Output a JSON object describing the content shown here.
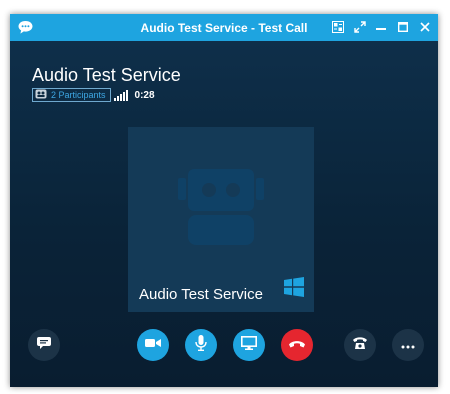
{
  "window": {
    "title": "Audio Test Service - Test Call"
  },
  "call": {
    "contact_name": "Audio Test Service",
    "participants_label": "2 Participants",
    "duration": "0:28",
    "tile_name": "Audio Test Service"
  },
  "icons": {
    "app": "chat-bubble-icon",
    "popout": "popout-icon",
    "fullscreen": "fullscreen-icon",
    "minimize": "minimize-icon",
    "maximize": "maximize-icon",
    "close": "close-icon",
    "conversation": "chat-icon",
    "video": "video-camera-icon",
    "mic": "microphone-icon",
    "screen": "screen-share-icon",
    "hangup": "hang-up-icon",
    "call_controls": "phone-icon",
    "more": "more-options-icon"
  },
  "colors": {
    "titlebar": "#1ea4e0",
    "stage": "#0d2a42",
    "tile": "#143a57",
    "robot": "#0f4166",
    "accent_blue": "#1ea4e0",
    "hangup_red": "#e5262f",
    "dark_button": "#1c3347"
  }
}
